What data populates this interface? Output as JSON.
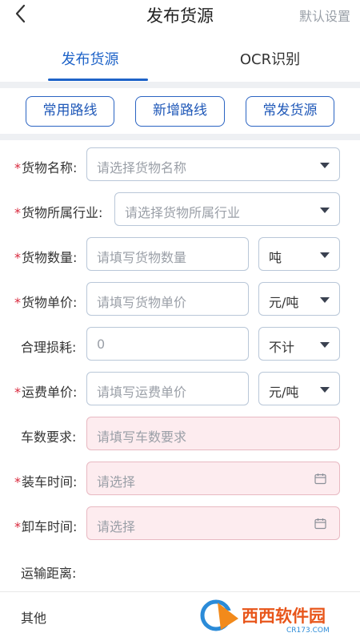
{
  "header": {
    "title": "发布货源",
    "right_action": "默认设置"
  },
  "tabs": [
    {
      "label": "发布货源",
      "active": true
    },
    {
      "label": "OCR识别",
      "active": false
    }
  ],
  "routes": [
    "常用路线",
    "新增路线",
    "常发货源"
  ],
  "form": {
    "goods_name": {
      "label": "货物名称:",
      "required": true,
      "placeholder": "请选择货物名称"
    },
    "industry": {
      "label": "货物所属行业:",
      "required": true,
      "placeholder": "请选择货物所属行业"
    },
    "quantity": {
      "label": "货物数量:",
      "required": true,
      "placeholder": "请填写货物数量",
      "unit": "吨"
    },
    "unit_price": {
      "label": "货物单价:",
      "required": true,
      "placeholder": "请填写货物单价",
      "unit": "元/吨"
    },
    "loss": {
      "label": "合理损耗:",
      "required": false,
      "value": "0",
      "unit": "不计"
    },
    "freight_price": {
      "label": "运费单价:",
      "required": true,
      "placeholder": "请填写运费单价",
      "unit": "元/吨"
    },
    "vehicles": {
      "label": "车数要求:",
      "required": false,
      "placeholder": "请填写车数要求"
    },
    "load_time": {
      "label": "装车时间:",
      "required": true,
      "placeholder": "请选择"
    },
    "unload_time": {
      "label": "卸车时间:",
      "required": true,
      "placeholder": "请选择"
    },
    "distance": {
      "label": "运输距离:"
    }
  },
  "other_label": "其他",
  "watermark": {
    "text": "西西软件园",
    "sub": "CR173.COM"
  },
  "colors": {
    "accent": "#1e63c8",
    "required": "#d9283c",
    "pink_field": "#fdecef"
  },
  "req_mark": "*"
}
